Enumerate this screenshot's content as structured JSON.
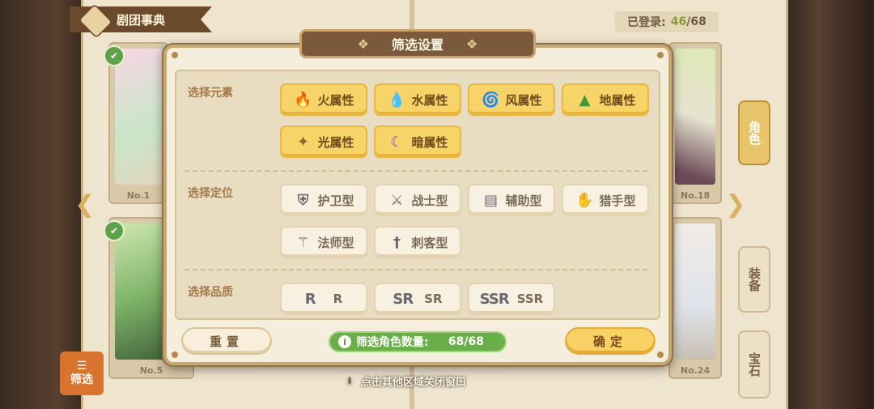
{
  "book": {
    "title": "剧团事典",
    "count_label": "已登录:",
    "count_value": "46",
    "count_total": "/68"
  },
  "cards": [
    {
      "label": "No.1"
    },
    {
      "label": "No.18"
    },
    {
      "label": "No.5"
    },
    {
      "label": "No.24"
    }
  ],
  "side_tabs": {
    "role": "角色",
    "equip": "装备",
    "gem": "宝石"
  },
  "filter_corner": "筛选",
  "hint": "点击其他区域关闭窗口",
  "modal": {
    "title": "筛选设置",
    "sections": {
      "element": {
        "label": "选择元素",
        "options": [
          {
            "label": "火属性",
            "icon": "fire-icon",
            "glyph": "🔥",
            "selected": true
          },
          {
            "label": "水属性",
            "icon": "water-drop-icon",
            "glyph": "💧",
            "selected": true
          },
          {
            "label": "风属性",
            "icon": "wind-swirl-icon",
            "glyph": "🌀",
            "selected": true
          },
          {
            "label": "地属性",
            "icon": "mountain-icon",
            "glyph": "⛰",
            "selected": true
          },
          {
            "label": "光属性",
            "icon": "light-star-icon",
            "glyph": "✦",
            "selected": true
          },
          {
            "label": "暗属性",
            "icon": "dark-moon-icon",
            "glyph": "☾",
            "selected": true
          }
        ]
      },
      "role": {
        "label": "选择定位",
        "options": [
          {
            "label": "护卫型",
            "icon": "shield-icon",
            "glyph": "🛡",
            "selected": false
          },
          {
            "label": "战士型",
            "icon": "sword-icon",
            "glyph": "⚔",
            "selected": false
          },
          {
            "label": "辅助型",
            "icon": "book-icon",
            "glyph": "📖",
            "selected": false
          },
          {
            "label": "猎手型",
            "icon": "claw-icon",
            "glyph": "✋",
            "selected": false
          },
          {
            "label": "法师型",
            "icon": "staff-icon",
            "glyph": "⚚",
            "selected": false
          },
          {
            "label": "刺客型",
            "icon": "dagger-icon",
            "glyph": "🗡",
            "selected": false
          }
        ]
      },
      "quality": {
        "label": "选择品质",
        "options": [
          {
            "label": "R",
            "badge": "R",
            "selected": false
          },
          {
            "label": "SR",
            "badge": "SR",
            "selected": false
          },
          {
            "label": "SSR",
            "badge": "SSR",
            "selected": false
          }
        ]
      }
    },
    "reset_label": "重置",
    "confirm_label": "确定",
    "result_label": "筛选角色数量:",
    "result_value": "68/68"
  },
  "colors": {
    "selected_chip": "#f6d468",
    "unselected_chip": "#f8f1e2",
    "accent_green": "#6aae4a",
    "header_brown": "#7a5a3a"
  }
}
